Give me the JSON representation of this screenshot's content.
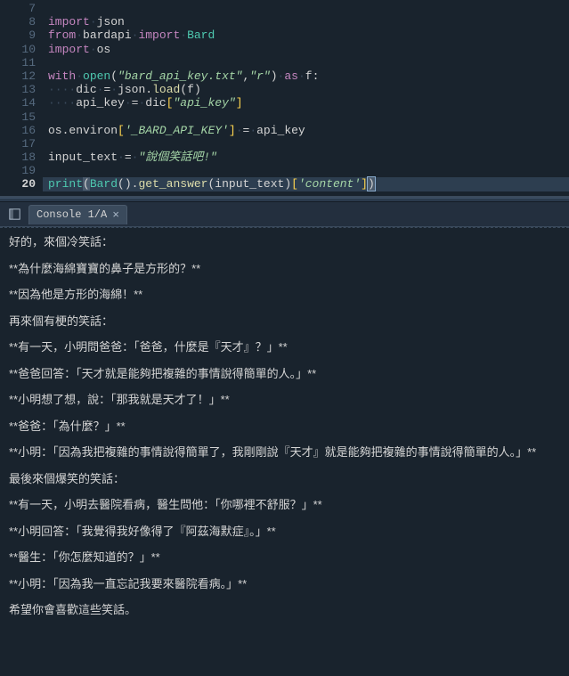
{
  "editor": {
    "line_numbers": [
      "7",
      "8",
      "9",
      "10",
      "11",
      "12",
      "13",
      "14",
      "15",
      "16",
      "17",
      "18",
      "19",
      "20"
    ],
    "current_line": "20",
    "lines": {
      "l7": "",
      "l8_import": "import",
      "l8_mod": "json",
      "l9_from": "from",
      "l9_mod": "bardapi",
      "l9_import": "import",
      "l9_name": "Bard",
      "l10_import": "import",
      "l10_mod": "os",
      "l12_with": "with",
      "l12_open": "open",
      "l12_str1": "\"bard_api_key.txt\"",
      "l12_str2": "\"r\"",
      "l12_as": "as",
      "l12_f": "f:",
      "l13_dic": "dic",
      "l13_json": "json",
      "l13_load": "load",
      "l13_arg": "f",
      "l14_apikey": "api_key",
      "l14_dic": "dic",
      "l14_key": "\"api_key\"",
      "l16_os": "os",
      "l16_environ": "environ",
      "l16_envkey": "'_BARD_API_KEY'",
      "l16_apikey": "api_key",
      "l18_input": "input_text",
      "l18_str": "\"說個笑話吧!\"",
      "l20_print": "print",
      "l20_bard": "Bard",
      "l20_get": "get_answer",
      "l20_arg": "input_text",
      "l20_key": "'content'"
    }
  },
  "console": {
    "tab_label": "Console 1/A",
    "output": {
      "p1": "好的，來個冷笑話：",
      "p2": "**為什麼海綿寶寶的鼻子是方形的？**",
      "p3": "**因為他是方形的海綿！**",
      "p4": "再來個有梗的笑話：",
      "p5": "**有一天，小明問爸爸：「爸爸，什麼是『天才』？」**",
      "p6": "**爸爸回答：「天才就是能夠把複雜的事情說得簡單的人。」**",
      "p7": "**小明想了想，說：「那我就是天才了！」**",
      "p8": "**爸爸：「為什麼？」**",
      "p9": "**小明：「因為我把複雜的事情說得簡單了，我剛剛說『天才』就是能夠把複雜的事情說得簡單的人。」**",
      "p10": "最後來個爆笑的笑話：",
      "p11": "**有一天，小明去醫院看病，醫生問他：「你哪裡不舒服？」**",
      "p12": "**小明回答：「我覺得我好像得了『阿茲海默症』。」**",
      "p13": "**醫生：「你怎麼知道的？」**",
      "p14": "**小明：「因為我一直忘記我要來醫院看病。」**",
      "p15": "希望你會喜歡這些笑話。"
    }
  }
}
